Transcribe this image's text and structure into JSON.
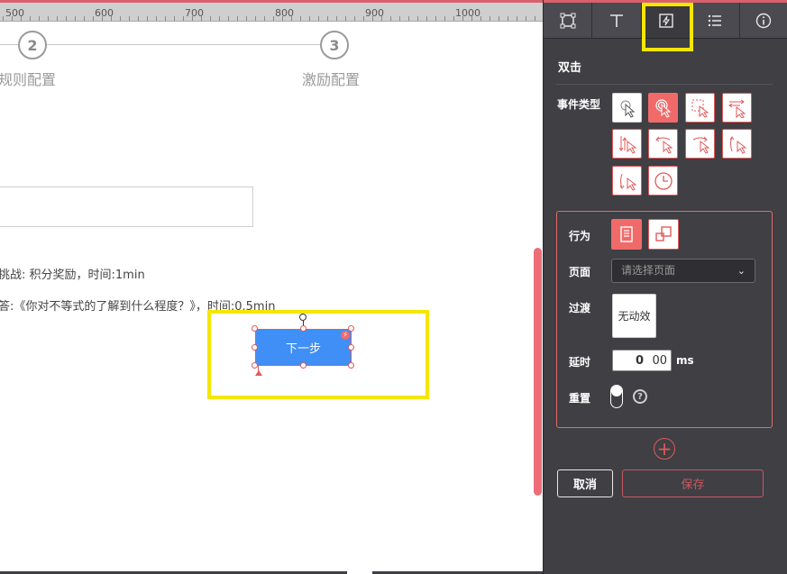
{
  "ruler": {
    "labels": [
      "500",
      "600",
      "700",
      "800",
      "900",
      "1000"
    ]
  },
  "steps": [
    {
      "number": "2",
      "label": "规则配置"
    },
    {
      "number": "3",
      "label": "激励配置"
    }
  ],
  "canvas": {
    "info_line_1": "挑战: 积分奖励，时间:1min",
    "info_line_2": "答:《你对不等式的了解到什么程度？》，时间:0.5min",
    "next_button_label": "下一步"
  },
  "panel": {
    "tabs": [
      {
        "name": "layout-tab",
        "icon": "frame-icon"
      },
      {
        "name": "text-tab",
        "icon": "text-icon"
      },
      {
        "name": "event-tab",
        "icon": "lightning-icon",
        "active": true
      },
      {
        "name": "list-tab",
        "icon": "list-icon"
      },
      {
        "name": "info-tab",
        "icon": "info-icon"
      }
    ],
    "section_title": "双击",
    "event_type_label": "事件类型",
    "behavior_label": "行为",
    "page_label": "页面",
    "page_placeholder": "请选择页面",
    "transition_label": "过渡",
    "transition_value": "无动效",
    "delay_label": "延时",
    "delay_seconds": "0",
    "delay_ms": "00",
    "delay_unit": "ms",
    "reset_label": "重置",
    "cancel_label": "取消",
    "save_label": "保存"
  },
  "colors": {
    "accent": "#f06a6a",
    "highlight": "#f5e600",
    "button_blue": "#3f8ff7",
    "panel_bg": "#3f3f44"
  }
}
